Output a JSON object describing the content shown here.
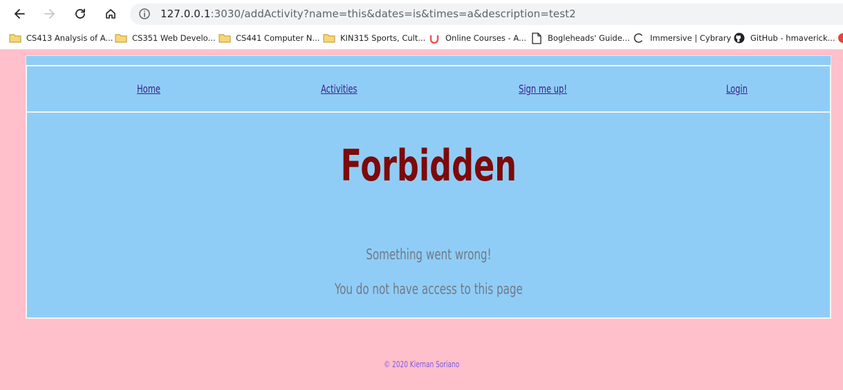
{
  "browser": {
    "url_host": "127.0.0.1",
    "url_rest": ":3030/addActivity?name=this&dates=is&times=a&description=test2",
    "back_icon": "arrow-left-icon",
    "forward_icon": "arrow-right-icon",
    "reload_icon": "reload-icon",
    "home_icon": "home-icon",
    "info_icon": "info-icon"
  },
  "bookmarks": [
    {
      "label": "CS413 Analysis of A...",
      "icon": "folder-icon"
    },
    {
      "label": "CS351 Web Develo...",
      "icon": "folder-icon"
    },
    {
      "label": "CS441 Computer N...",
      "icon": "folder-icon"
    },
    {
      "label": "KIN315 Sports, Cult...",
      "icon": "folder-icon"
    },
    {
      "label": "Online Courses - A...",
      "icon": "udemy-icon"
    },
    {
      "label": "Bogleheads' Guide...",
      "icon": "page-icon"
    },
    {
      "label": "Immersive | Cybrary",
      "icon": "cybrary-icon"
    },
    {
      "label": "GitHub - hmaverick...",
      "icon": "github-icon"
    }
  ],
  "site_nav": {
    "home": "Home",
    "activities": "Activities",
    "signup": "Sign me up!",
    "login": "Login"
  },
  "main": {
    "title": "Forbidden",
    "message": "Something went wrong!",
    "detail": "You do not have access to this page"
  },
  "footer": {
    "text": "© 2020 Kiernan Soriano"
  },
  "colors": {
    "page_bg": "#ffc0cb",
    "panel_bg": "#90cdf6",
    "title": "#7d0a0a",
    "link": "#3a1f8a",
    "footer": "#7b5be0"
  }
}
